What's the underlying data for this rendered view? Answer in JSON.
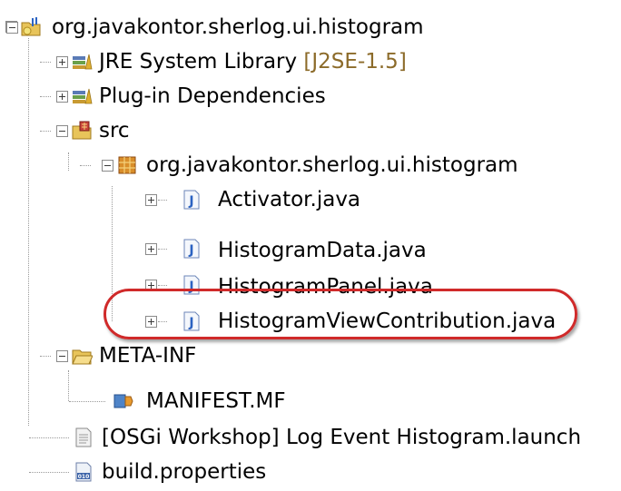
{
  "tree": {
    "project": "org.javakontor.sherlog.ui.histogram",
    "jre": {
      "label": "JRE System Library",
      "suffix": "[J2SE-1.5]"
    },
    "plugin_deps": "Plug-in Dependencies",
    "src": "src",
    "package": "org.javakontor.sherlog.ui.histogram",
    "files": [
      "Activator.java",
      "HistogramData.java",
      "HistogramPanel.java",
      "HistogramViewContribution.java"
    ],
    "meta_inf": "META-INF",
    "manifest": "MANIFEST.MF",
    "launch": "[OSGi Workshop] Log Event Histogram.launch",
    "build_props": "build.properties"
  },
  "colors": {
    "highlight": "#d02a2a",
    "decorator": "#8c6b2a",
    "java_icon": "#2c63c2",
    "folder": "#e8c45a"
  },
  "icons": {
    "project": "project-folder-icon",
    "library": "library-icon",
    "source": "source-folder-icon",
    "package": "package-icon",
    "java": "java-file-icon",
    "folder": "folder-icon",
    "manifest": "manifest-icon",
    "launch": "launch-file-icon",
    "properties": "properties-file-icon"
  }
}
